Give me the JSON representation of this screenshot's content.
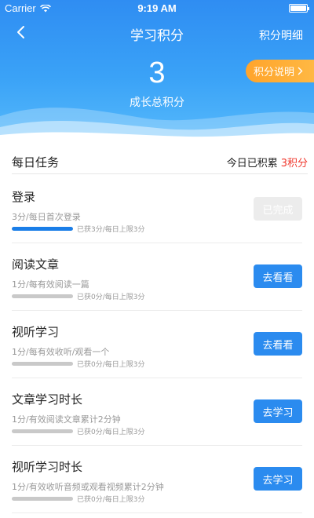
{
  "status_bar": {
    "carrier": "Carrier",
    "time": "9:19 AM"
  },
  "nav": {
    "title": "学习积分",
    "right_link": "积分明细"
  },
  "score": {
    "value": "3",
    "label": "成长总积分"
  },
  "rule_button": {
    "label": "积分说明"
  },
  "daily": {
    "title": "每日任务",
    "today_label": "今日已积累",
    "today_points": "3积分"
  },
  "tasks": [
    {
      "name": "登录",
      "desc": "3分/每日首次登录",
      "progress_text": "已获3分/每日上限3分",
      "progress": 1.0,
      "action": "已完成",
      "done": true
    },
    {
      "name": "阅读文章",
      "desc": "1分/每有效阅读一篇",
      "progress_text": "已获0分/每日上限3分",
      "progress": 0.0,
      "action": "去看看",
      "done": false
    },
    {
      "name": "视听学习",
      "desc": "1分/每有效收听/观看一个",
      "progress_text": "已获0分/每日上限3分",
      "progress": 0.0,
      "action": "去看看",
      "done": false
    },
    {
      "name": "文章学习时长",
      "desc": "1分/有效阅读文章累计2分钟",
      "progress_text": "已获0分/每日上限3分",
      "progress": 0.0,
      "action": "去学习",
      "done": false
    },
    {
      "name": "视听学习时长",
      "desc": "1分/有效收听音频或观看视频累计2分钟",
      "progress_text": "已获0分/每日上限3分",
      "progress": 0.0,
      "action": "去学习",
      "done": false
    }
  ],
  "icons": {
    "back": "chevron-left-icon",
    "wifi": "wifi-icon",
    "battery": "battery-icon",
    "rule_arrow": "chevron-right-icon"
  },
  "colors": {
    "header_blue": "#2f8df2",
    "action_blue": "#2b8bef",
    "accent_orange": "#ffa42b",
    "points_red": "#f0382d"
  }
}
